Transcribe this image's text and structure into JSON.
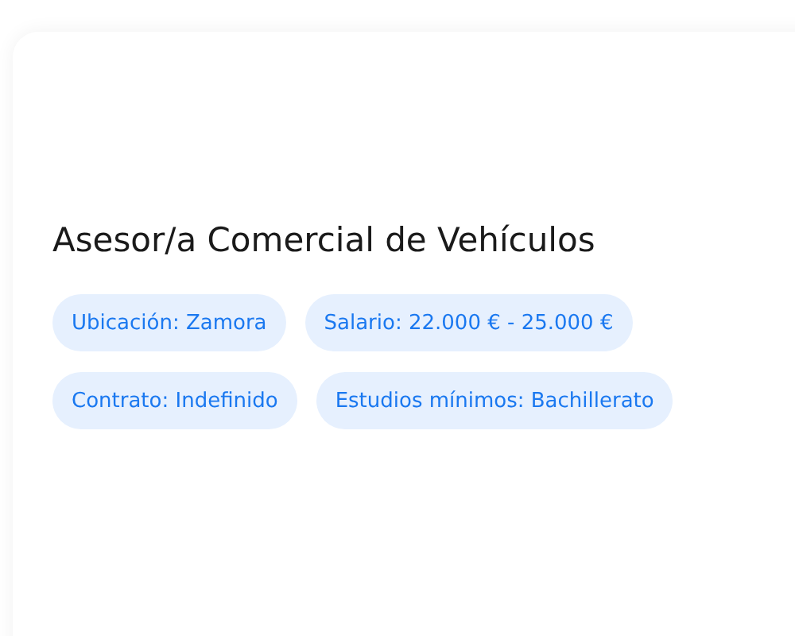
{
  "job": {
    "title": "Asesor/a Comercial de Vehículos",
    "tags": [
      {
        "label": "Ubicación: Zamora"
      },
      {
        "label": "Salario: 22.000 € - 25.000 €"
      },
      {
        "label": "Contrato: Indefinido"
      },
      {
        "label": "Estudios mínimos: Bachillerato"
      }
    ]
  }
}
